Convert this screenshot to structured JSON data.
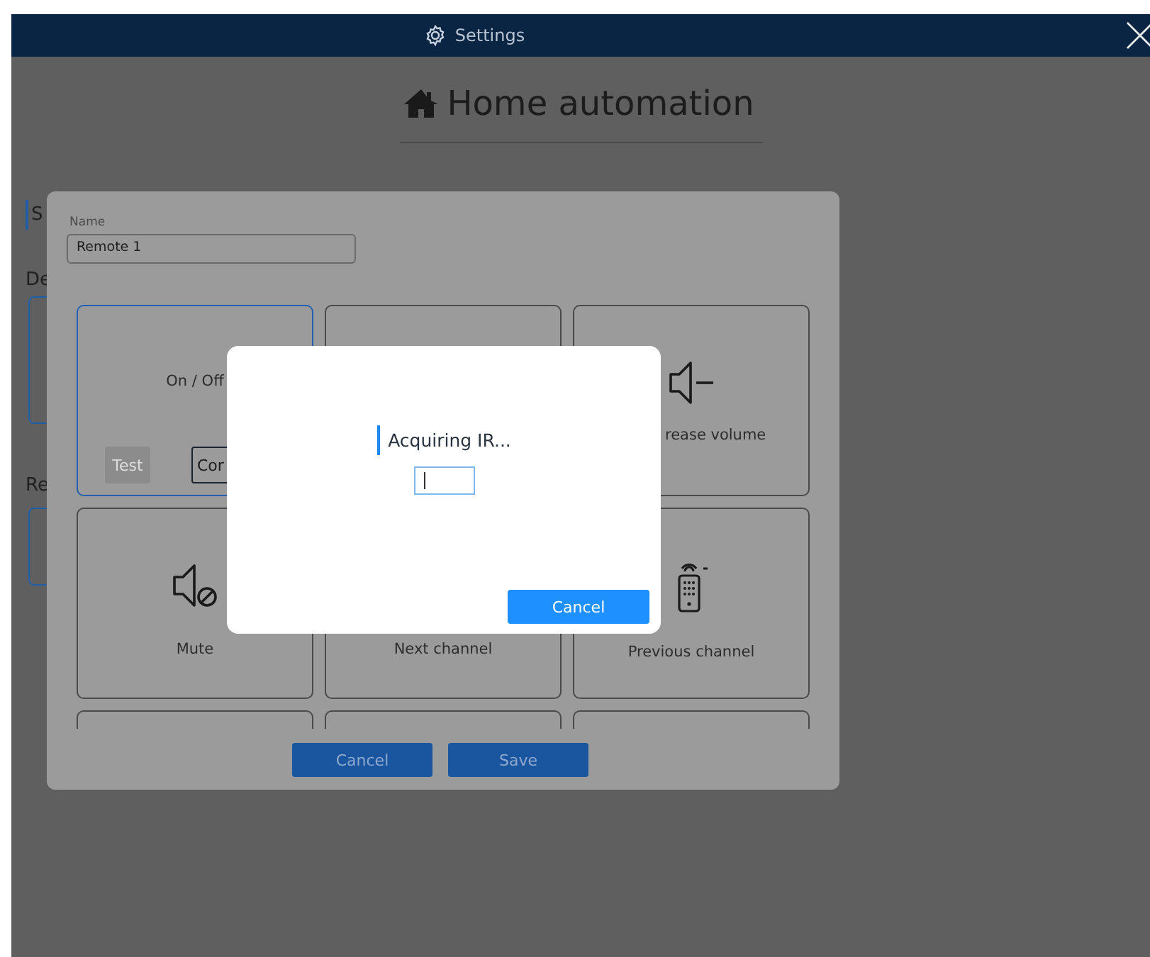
{
  "window": {
    "title": "Settings"
  },
  "page": {
    "heading": "Home automation",
    "background_labels": [
      "S",
      "De",
      "Re"
    ]
  },
  "form": {
    "name_label": "Name",
    "name_value": "Remote 1",
    "tiles": [
      {
        "kind": "power",
        "label": "On / Off",
        "selected": true,
        "buttons": [
          {
            "label": "Test",
            "disabled": true
          },
          {
            "label": "Cor",
            "disabled": false
          }
        ]
      },
      {
        "kind": "hidden",
        "selected": false
      },
      {
        "kind": "volume_down",
        "label": "rease volume",
        "selected": false
      },
      {
        "kind": "mute",
        "label": "Mute",
        "selected": false
      },
      {
        "kind": "plain",
        "label": "Next channel",
        "selected": false
      },
      {
        "kind": "remote",
        "label": "Previous channel",
        "selected": false
      },
      {
        "kind": "hidden",
        "selected": false
      },
      {
        "kind": "hidden",
        "selected": false
      },
      {
        "kind": "hidden",
        "selected": false
      }
    ],
    "buttons": [
      "Cancel",
      "Save"
    ]
  },
  "dialog": {
    "message": "Acquiring IR...",
    "cancel": "Cancel"
  }
}
